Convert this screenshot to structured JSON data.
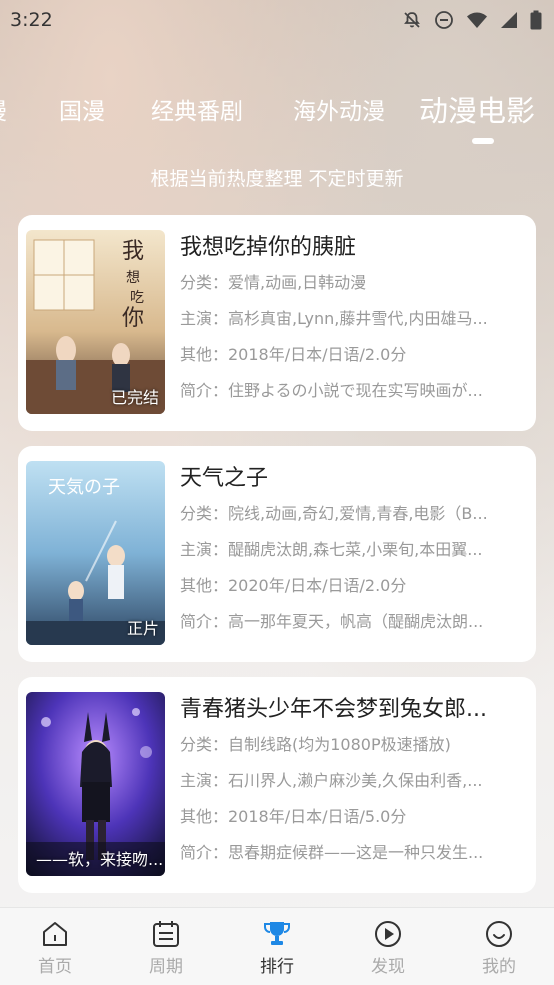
{
  "status": {
    "time": "3:22"
  },
  "tabs": [
    "漫",
    "国漫",
    "经典番剧",
    "海外动漫",
    "动漫电影"
  ],
  "active_tab": 4,
  "subtitle": "根据当前热度整理 不定时更新",
  "items": [
    {
      "title": "我想吃掉你的胰脏",
      "category": "分类：爱情,动画,日韩动漫",
      "cast": "主演：高杉真宙,Lynn,藤井雪代,内田雄马...",
      "other": "其他：2018年/日本/日语/2.0分",
      "intro": "简介：住野よるの小説で现在实写映画が...",
      "badge": "已完结",
      "poster_colors": [
        "#f1e2c4",
        "#b9825a",
        "#4a3a33"
      ]
    },
    {
      "title": "天气之子",
      "category": "分类：院线,动画,奇幻,爱情,青春,电影（B...",
      "cast": "主演：醍醐虎汰朗,森七菜,小栗旬,本田翼...",
      "other": "其他：2020年/日本/日语/2.0分",
      "intro": "简介：高一那年夏天，帆高（醍醐虎汰朗...",
      "badge": "正片",
      "poster_colors": [
        "#a9cde6",
        "#5e8fb8",
        "#2d3f5a"
      ]
    },
    {
      "title": "青春猪头少年不会梦到兔女郎...",
      "category": "分类：自制线路(均为1080P极速播放)",
      "cast": "主演：石川界人,濑户麻沙美,久保由利香,...",
      "other": "其他：2018年/日本/日语/5.0分",
      "intro": "简介：思春期症候群——这是一种只发生...",
      "badge": "——软，来接吻...",
      "poster_colors": [
        "#7a4fd6",
        "#3a2a8a",
        "#12122e"
      ]
    }
  ],
  "nav": [
    {
      "label": "首页",
      "icon": "home-icon"
    },
    {
      "label": "周期",
      "icon": "calendar-icon"
    },
    {
      "label": "排行",
      "icon": "trophy-icon"
    },
    {
      "label": "发现",
      "icon": "play-circle-icon"
    },
    {
      "label": "我的",
      "icon": "smile-icon"
    }
  ],
  "nav_active": 2,
  "accent_color": "#1e88e5"
}
